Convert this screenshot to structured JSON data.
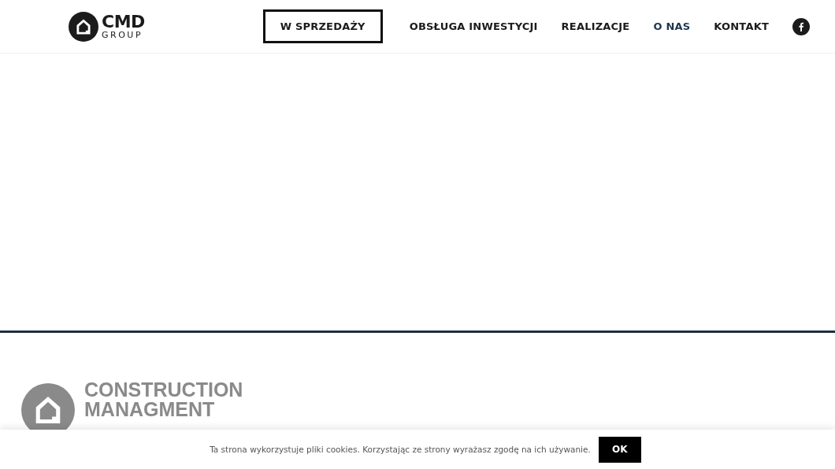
{
  "header": {
    "logo": {
      "name": "CMD",
      "sub": "GROUP"
    },
    "nav": [
      {
        "label": "W SPRZEDAŻY",
        "kind": "boxed",
        "selected": false
      },
      {
        "label": "OBSŁUGA INWESTYCJI",
        "kind": "link",
        "selected": false
      },
      {
        "label": "REALIZACJE",
        "kind": "link",
        "selected": false
      },
      {
        "label": "O NAS",
        "kind": "link",
        "selected": true
      },
      {
        "label": "KONTAKT",
        "kind": "link",
        "selected": false
      }
    ]
  },
  "footer_logo": {
    "lines": [
      "CONSTRUCTION",
      "MANAGMENT"
    ]
  },
  "cookie_bar": {
    "text": "Ta strona wykorzystuje pliki cookies. Korzystając ze strony wyrażasz zgodę na ich używanie.",
    "button": "OK"
  }
}
